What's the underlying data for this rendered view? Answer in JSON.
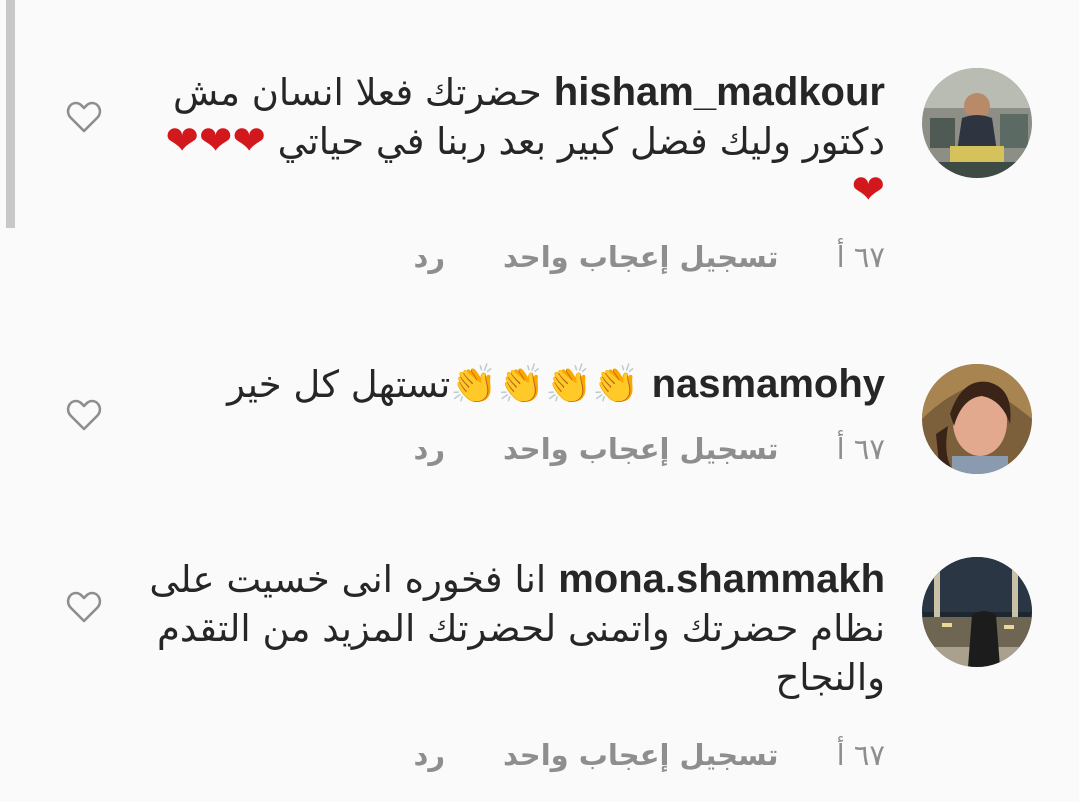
{
  "comments": [
    {
      "username": "hisham_madkour",
      "text": "حضرتك فعلا انسان مش دكتور  وليك فضل كبير بعد ربنا في حياتي",
      "emoji_trailing": "❤❤❤❤",
      "time": "٦٧ أ",
      "likes": "تسجيل إعجاب واحد",
      "reply": "رد"
    },
    {
      "username": "nasmamohy",
      "text": "تستهل كل خير",
      "emoji_leading": "👏👏👏👏",
      "time": "٦٧ أ",
      "likes": "تسجيل إعجاب واحد",
      "reply": "رد"
    },
    {
      "username": "mona.shammakh",
      "text": "انا فخوره انى خسيت على نظام حضرتك واتمنى لحضرتك المزيد من التقدم والنجاح",
      "time": "٦٧ أ",
      "likes": "تسجيل إعجاب واحد",
      "reply": "رد"
    }
  ],
  "colors": {
    "background": "#fafafa",
    "text": "#262626",
    "meta": "#8e8e8e",
    "heart_emoji": "#d3181d"
  }
}
